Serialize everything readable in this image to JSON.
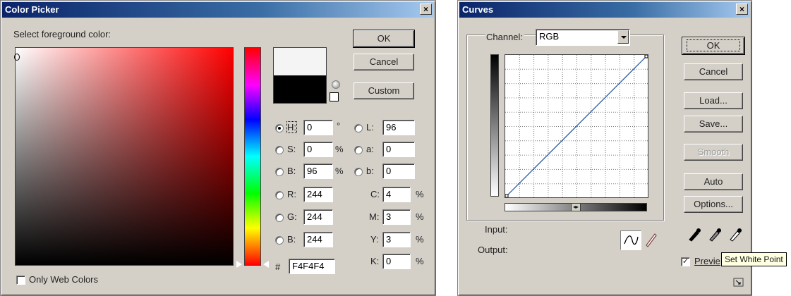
{
  "color_picker": {
    "title": "Color Picker",
    "close_glyph": "×",
    "prompt": "Select foreground color:",
    "buttons": {
      "ok": "OK",
      "cancel": "Cancel",
      "custom": "Custom"
    },
    "hsb": [
      {
        "label": "H:",
        "value": "0",
        "unit": "°",
        "selected": true
      },
      {
        "label": "S:",
        "value": "0",
        "unit": "%",
        "selected": false
      },
      {
        "label": "B:",
        "value": "96",
        "unit": "%",
        "selected": false
      }
    ],
    "lab": [
      {
        "label": "L:",
        "value": "96",
        "selected": false
      },
      {
        "label": "a:",
        "value": "0",
        "selected": false
      },
      {
        "label": "b:",
        "value": "0",
        "selected": false
      }
    ],
    "rgb": [
      {
        "label": "R:",
        "value": "244",
        "selected": false
      },
      {
        "label": "G:",
        "value": "244",
        "selected": false
      },
      {
        "label": "B:",
        "value": "244",
        "selected": false
      }
    ],
    "cmyk": [
      {
        "label": "C:",
        "value": "4",
        "unit": "%"
      },
      {
        "label": "M:",
        "value": "3",
        "unit": "%"
      },
      {
        "label": "Y:",
        "value": "3",
        "unit": "%"
      },
      {
        "label": "K:",
        "value": "0",
        "unit": "%"
      }
    ],
    "hex_label": "#",
    "hex_value": "F4F4F4",
    "only_web_colors": "Only Web Colors",
    "new_color": "#f4f4f4",
    "old_color": "#000000"
  },
  "curves": {
    "title": "Curves",
    "close_glyph": "×",
    "channel_label": "Channel:",
    "channel_value": "RGB",
    "buttons": {
      "ok": "OK",
      "cancel": "Cancel",
      "load": "Load...",
      "save": "Save...",
      "smooth": "Smooth",
      "auto": "Auto",
      "options": "Options..."
    },
    "input_label": "Input:",
    "output_label": "Output:",
    "preview_label": "Previe",
    "preview_checked": "✓",
    "tooltip": "Set White Point",
    "curve_color": "#1f4e9c"
  }
}
